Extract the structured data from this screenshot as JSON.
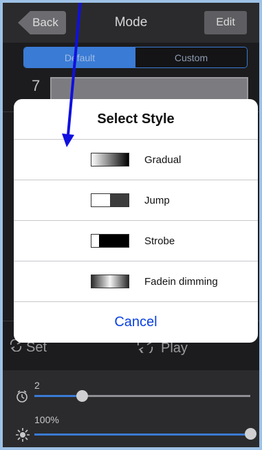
{
  "navbar": {
    "back_label": "Back",
    "title": "Mode",
    "edit_label": "Edit"
  },
  "segmented": {
    "options": [
      "Default",
      "Custom"
    ],
    "selected": "Default"
  },
  "mode_number": "7",
  "actions": {
    "set_label": "Set",
    "play_label": "Play"
  },
  "sliders": {
    "speed": {
      "value_text": "2",
      "fraction": 0.22,
      "icon": "clock-icon"
    },
    "brightness": {
      "value_text": "100%",
      "fraction": 1.0,
      "icon": "sun-icon"
    }
  },
  "dialog": {
    "title": "Select Style",
    "options": [
      {
        "label": "Gradual",
        "swatch": "gradual"
      },
      {
        "label": "Jump",
        "swatch": "jump"
      },
      {
        "label": "Strobe",
        "swatch": "strobe"
      },
      {
        "label": "Fadein dimming",
        "swatch": "fadein"
      }
    ],
    "cancel_label": "Cancel"
  },
  "colors": {
    "accent": "#3a7bd5",
    "cancel": "#0a40e0",
    "annotation_arrow": "#1010e0"
  }
}
